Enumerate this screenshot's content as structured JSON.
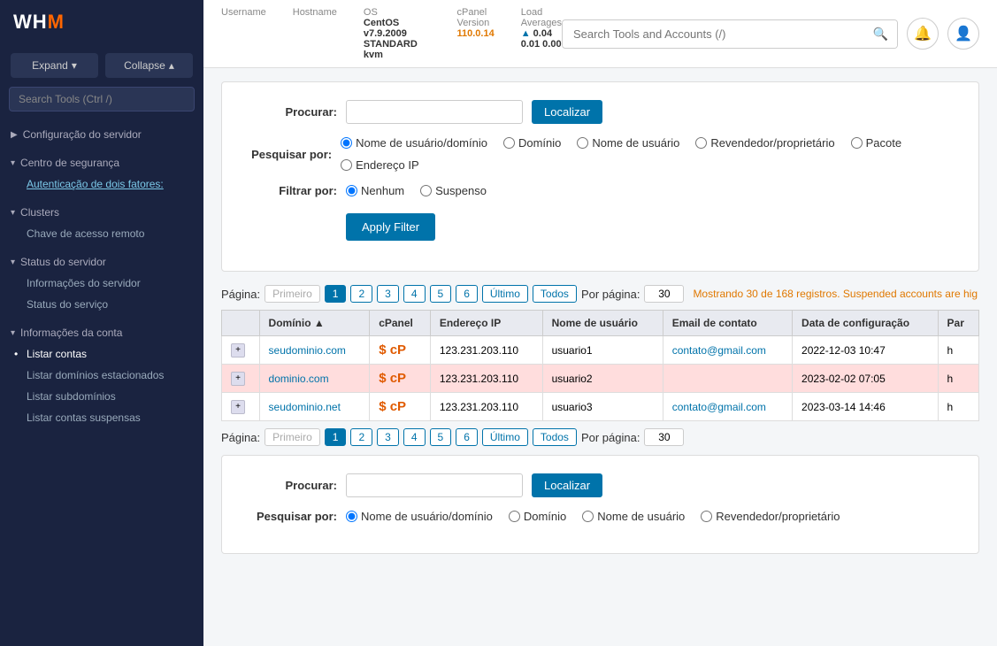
{
  "logo": {
    "text": "WHM",
    "accent": "M"
  },
  "sidebar": {
    "expand_label": "Expand",
    "collapse_label": "Collapse",
    "search_placeholder": "Search Tools (Ctrl /)",
    "sections": [
      {
        "id": "server-config",
        "label": "Configuração do servidor",
        "expanded": false,
        "items": []
      },
      {
        "id": "security-center",
        "label": "Centro de segurança",
        "expanded": true,
        "items": [
          {
            "id": "two-factor-auth",
            "label": "Autenticação de dois fatores:",
            "link": true
          }
        ]
      },
      {
        "id": "clusters",
        "label": "Clusters",
        "expanded": true,
        "items": [
          {
            "id": "remote-key",
            "label": "Chave de acesso remoto",
            "link": false
          }
        ]
      },
      {
        "id": "server-status",
        "label": "Status do servidor",
        "expanded": true,
        "items": [
          {
            "id": "server-info",
            "label": "Informações do servidor",
            "link": false
          },
          {
            "id": "service-status",
            "label": "Status do serviço",
            "link": false
          }
        ]
      },
      {
        "id": "account-info",
        "label": "Informações da conta",
        "expanded": true,
        "items": [
          {
            "id": "list-accounts",
            "label": "Listar contas",
            "link": false,
            "active": true
          },
          {
            "id": "list-parked",
            "label": "Listar domínios estacionados",
            "link": false
          },
          {
            "id": "list-subdomains",
            "label": "Listar subdomínios",
            "link": false
          },
          {
            "id": "list-suspended",
            "label": "Listar contas suspensas",
            "link": false
          }
        ]
      }
    ]
  },
  "topbar": {
    "username_label": "Username",
    "hostname_label": "Hostname",
    "os_label": "OS",
    "os_value": "CentOS v7.9.2009 STANDARD kvm",
    "cpanel_version_label": "cPanel Version",
    "cpanel_version_value": "110.0.14",
    "load_avg_label": "Load Averages",
    "load_avg_values": "0.04  0.01  0.00",
    "search_placeholder": "Search Tools and Accounts (/)"
  },
  "filter_panel": {
    "search_label": "Procurar:",
    "search_placeholder": "",
    "localizar_label": "Localizar",
    "search_by_label": "Pesquisar por:",
    "search_by_options": [
      {
        "id": "user-domain",
        "label": "Nome de usuário/domínio",
        "checked": true
      },
      {
        "id": "domain",
        "label": "Domínio",
        "checked": false
      },
      {
        "id": "username",
        "label": "Nome de usuário",
        "checked": false
      },
      {
        "id": "reseller",
        "label": "Revendedor/proprietário",
        "checked": false
      },
      {
        "id": "package",
        "label": "Pacote",
        "checked": false
      },
      {
        "id": "ip",
        "label": "Endereço IP",
        "checked": false
      }
    ],
    "filter_by_label": "Filtrar por:",
    "filter_by_options": [
      {
        "id": "none",
        "label": "Nenhum",
        "checked": true
      },
      {
        "id": "suspended",
        "label": "Suspenso",
        "checked": false
      }
    ],
    "apply_filter_label": "Apply Filter"
  },
  "pagination": {
    "page_label": "Página:",
    "first_label": "Primeiro",
    "last_label": "Último",
    "all_label": "Todos",
    "pages": [
      "1",
      "2",
      "3",
      "4",
      "5",
      "6"
    ],
    "current_page": "1",
    "per_page_label": "Por página:",
    "per_page_value": "30",
    "records_info": "Mostrando 30 de 168 registros.",
    "suspended_notice": "Suspended accounts are hig"
  },
  "table": {
    "columns": [
      {
        "id": "expand",
        "label": ""
      },
      {
        "id": "domain",
        "label": "Domínio",
        "sortable": true
      },
      {
        "id": "cpanel",
        "label": "cPanel",
        "sortable": false
      },
      {
        "id": "ip",
        "label": "Endereço IP",
        "sortable": false
      },
      {
        "id": "username",
        "label": "Nome de usuário",
        "sortable": false
      },
      {
        "id": "email",
        "label": "Email de contato",
        "sortable": false
      },
      {
        "id": "created",
        "label": "Data de configuração",
        "sortable": false
      },
      {
        "id": "partial",
        "label": "Par",
        "sortable": false
      }
    ],
    "rows": [
      {
        "id": "row1",
        "suspended": false,
        "domain": "seudominio.com",
        "cpanel": "cP",
        "ip": "123.231.203.110",
        "username": "usuario1",
        "email": "contato@gmail.com",
        "created": "2022-12-03 10:47",
        "partial": "h"
      },
      {
        "id": "row2",
        "suspended": true,
        "domain": "dominio.com",
        "cpanel": "cP",
        "ip": "123.231.203.110",
        "username": "usuario2",
        "email": "",
        "created": "2023-02-02 07:05",
        "partial": "h"
      },
      {
        "id": "row3",
        "suspended": false,
        "domain": "seudominio.net",
        "cpanel": "cP",
        "ip": "123.231.203.110",
        "username": "usuario3",
        "email": "contato@gmail.com",
        "created": "2023-03-14 14:46",
        "partial": "h"
      }
    ]
  },
  "pagination_bottom": {
    "page_label": "Página:",
    "first_label": "Primeiro",
    "last_label": "Último",
    "all_label": "Todos",
    "pages": [
      "1",
      "2",
      "3",
      "4",
      "5",
      "6"
    ],
    "current_page": "1",
    "per_page_label": "Por página:",
    "per_page_value": "30"
  },
  "filter_panel2": {
    "search_label": "Procurar:",
    "search_placeholder": "",
    "localizar_label": "Localizar",
    "search_by_label": "Pesquisar por:",
    "search_by_options": [
      {
        "id": "user-domain2",
        "label": "Nome de usuário/domínio",
        "checked": true
      },
      {
        "id": "domain2",
        "label": "Domínio",
        "checked": false
      },
      {
        "id": "username2",
        "label": "Nome de usuário",
        "checked": false
      },
      {
        "id": "reseller2",
        "label": "Revendedor/proprietário",
        "checked": false
      }
    ]
  }
}
